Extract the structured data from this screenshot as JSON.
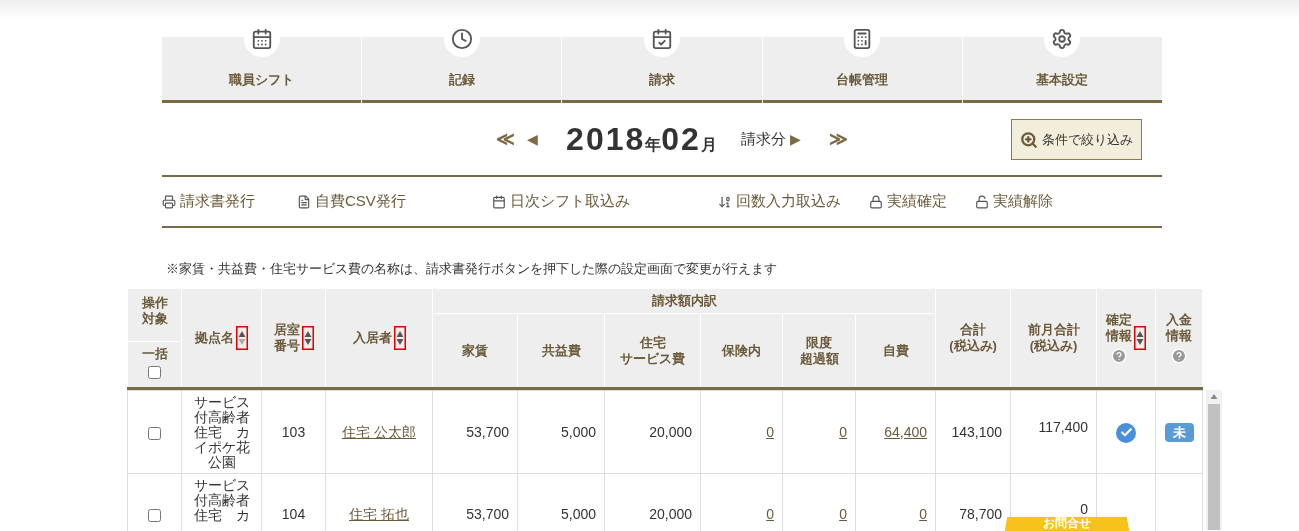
{
  "nav_tabs": [
    {
      "label": "職員シフト",
      "kind": "calendar"
    },
    {
      "label": "記録",
      "kind": "clock"
    },
    {
      "label": "請求",
      "kind": "calendar-check"
    },
    {
      "label": "台帳管理",
      "kind": "calculator"
    },
    {
      "label": "基本設定",
      "kind": "gear"
    }
  ],
  "period": {
    "first": "≪",
    "prev": "◀",
    "year": "2018",
    "year_unit": "年",
    "month": "02",
    "month_unit": "月",
    "suffix": "請求分",
    "next": "▶",
    "last": "≫"
  },
  "filter_button": "条件で絞り込み",
  "actions": [
    {
      "label": "請求書発行",
      "kind": "print"
    },
    {
      "label": "自費CSV発行",
      "kind": "file"
    },
    {
      "label": "日次シフト取込み",
      "kind": "calendar"
    },
    {
      "label": "回数入力取込み",
      "kind": "sort"
    },
    {
      "label": "実績確定",
      "kind": "lock"
    },
    {
      "label": "実績解除",
      "kind": "unlock"
    }
  ],
  "note": "※家賃・共益費・住宅サービス費の名称は、請求書発行ボタンを押下した際の設定画面で変更が行えます",
  "header": {
    "target_lines": [
      "操作",
      "対象"
    ],
    "bulk_label": "一括",
    "bulk_checked": false,
    "lead_columns": [
      {
        "lines": [
          "拠点名"
        ],
        "sortable": true,
        "sorted": true
      },
      {
        "lines": [
          "居室",
          "番号"
        ],
        "sortable": true,
        "sorted": false
      },
      {
        "lines": [
          "入居者"
        ],
        "sortable": true,
        "sorted": false
      }
    ],
    "group_label": "請求額内訳",
    "group_columns": [
      {
        "lines": [
          "家賃"
        ]
      },
      {
        "lines": [
          "共益費"
        ]
      },
      {
        "lines": [
          "住宅",
          "サービス費"
        ]
      },
      {
        "lines": [
          "保険内"
        ]
      },
      {
        "lines": [
          "限度",
          "超過額"
        ]
      },
      {
        "lines": [
          "自費"
        ]
      }
    ],
    "tail_columns": [
      {
        "lines": [
          "合計",
          "(税込み)"
        ]
      },
      {
        "lines": [
          "前月合計",
          "(税込み)"
        ]
      },
      {
        "lines": [
          "確定",
          "情報"
        ],
        "sortable": true,
        "sorted": false,
        "help": true
      },
      {
        "lines": [
          "入金",
          "情報"
        ],
        "help": true
      }
    ]
  },
  "rows": [
    {
      "checked": false,
      "location": "サービス付高齢者住宅　カイポケ花公園",
      "room": "103",
      "resident": "住宅 公太郎",
      "rent": "53,700",
      "common": "5,000",
      "housing": "20,000",
      "insured": "0",
      "excess": "0",
      "self_pay": "64,400",
      "total": "143,100",
      "prev_total": "117,400",
      "confirmed": true,
      "payment": "未"
    },
    {
      "checked": false,
      "location": "サービス付高齢者住宅　カ",
      "room": "104",
      "resident": "住宅 拓也",
      "rent": "53,700",
      "common": "5,000",
      "housing": "20,000",
      "insured": "0",
      "excess": "0",
      "self_pay": "0",
      "total": "78,700",
      "prev_total": "0",
      "confirmed": false
    }
  ],
  "contact_tab": "お問合せ"
}
